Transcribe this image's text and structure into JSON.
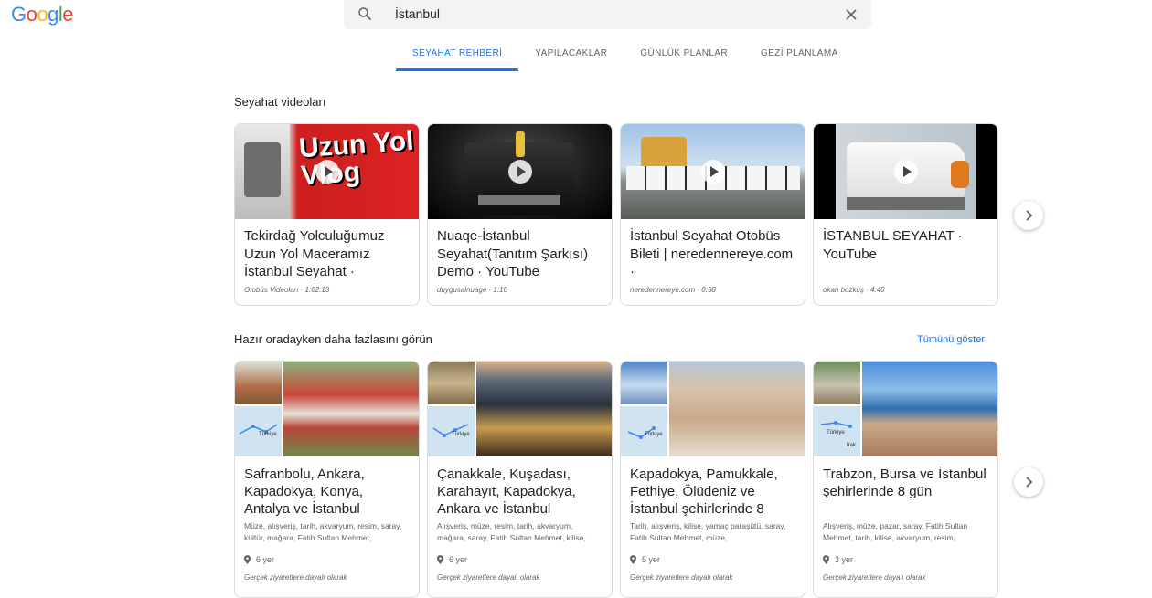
{
  "logo": {
    "letters": [
      "G",
      "o",
      "o",
      "g",
      "l",
      "e"
    ],
    "colors": [
      "#4285f4",
      "#ea4335",
      "#fbbc05",
      "#4285f4",
      "#34a853",
      "#ea4335"
    ]
  },
  "search": {
    "query": "İstanbul",
    "icon": "search-icon",
    "clear_icon": "close-icon"
  },
  "tabs": [
    {
      "label": "SEYAHAT REHBERİ",
      "active": true
    },
    {
      "label": "YAPILACAKLAR"
    },
    {
      "label": "GÜNLÜK PLANLAR"
    },
    {
      "label": "GEZİ PLANLAMA"
    }
  ],
  "videos": {
    "title": "Seyahat videoları",
    "items": [
      {
        "title": "Tekirdağ Yolculuğumuz Uzun Yol Maceramız İstanbul Seyahat ·",
        "meta": "Otobüs Videoları · 1:02:13",
        "thumb_text": "Uzun Yol Vlog"
      },
      {
        "title": "Nuaqe-İstanbul Seyahat(Tanıtım Şarkısı) Demo · YouTube",
        "meta": "duygusalnuage · 1:10"
      },
      {
        "title": "İstanbul Seyahat Otobüs Bileti | neredennereye.com ·",
        "meta": "neredennereye.com · 0:58"
      },
      {
        "title": "İSTANBUL SEYAHAT · YouTube",
        "meta": "okan bozkuş · 4:40"
      }
    ]
  },
  "trips": {
    "title": "Hazır oradayken daha fazlasını görün",
    "see_all": "Tümünü göster",
    "map_label": "Türkiye",
    "items": [
      {
        "title": "Safranbolu, Ankara, Kapadokya, Konya, Antalya ve İstanbul",
        "desc": "Müze, alışveriş, tarih, akvaryum, resim, saray, kültür, mağara, Fatih Sultan Mehmet,",
        "duration": "6 yer",
        "note": "Gerçek ziyaretlere dayalı olarak"
      },
      {
        "title": "Çanakkale, Kuşadası, Karahayıt, Kapadokya, Ankara ve İstanbul",
        "desc": "Alışveriş, müze, resim, tarih, akvaryum, mağara, saray, Fatih Sultan Mehmet, kilise,",
        "duration": "6 yer",
        "note": "Gerçek ziyaretlere dayalı olarak"
      },
      {
        "title": "Kapadokya, Pamukkale, Fethiye, Ölüdeniz ve İstanbul şehirlerinde 8",
        "desc": "Tarih, alışveriş, kilise, yamaç paraşütü, saray, Fatih Sultan Mehmet, müze,",
        "duration": "5 yer",
        "note": "Gerçek ziyaretlere dayalı olarak"
      },
      {
        "title": "Trabzon, Bursa ve İstanbul şehirlerinde 8 gün",
        "desc": "Alışveriş, müze, pazar, saray, Fatih Sultan Mehmet, tarih, kilise, akvaryum, resim,",
        "duration": "3 yer",
        "note": "Gerçek ziyaretlere dayalı olarak",
        "map_extra": "Irak"
      }
    ]
  }
}
